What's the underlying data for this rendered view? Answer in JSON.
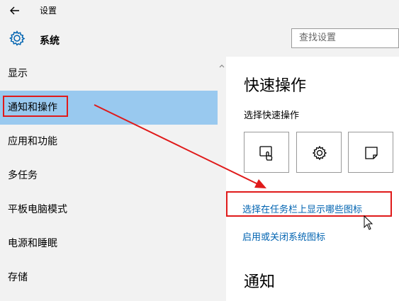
{
  "window": {
    "title": "设置"
  },
  "header": {
    "section_title": "系统",
    "search_placeholder": "查找设置"
  },
  "sidebar": {
    "items": [
      {
        "label": "显示"
      },
      {
        "label": "通知和操作"
      },
      {
        "label": "应用和功能"
      },
      {
        "label": "多任务"
      },
      {
        "label": "平板电脑模式"
      },
      {
        "label": "电源和睡眠"
      },
      {
        "label": "存储"
      }
    ],
    "active_index": 1
  },
  "main": {
    "quick_actions_title": "快速操作",
    "quick_actions_subtitle": "选择快速操作",
    "tiles": [
      {
        "icon": "tablet-mode-icon"
      },
      {
        "icon": "gear-icon"
      },
      {
        "icon": "note-icon"
      }
    ],
    "link_taskbar_icons": "选择在任务栏上显示哪些图标",
    "link_system_icons": "启用或关闭系统图标",
    "notifications_title": "通知"
  },
  "colors": {
    "accent": "#99c9ef",
    "link": "#0063b1",
    "annotation": "#e01a1a"
  }
}
